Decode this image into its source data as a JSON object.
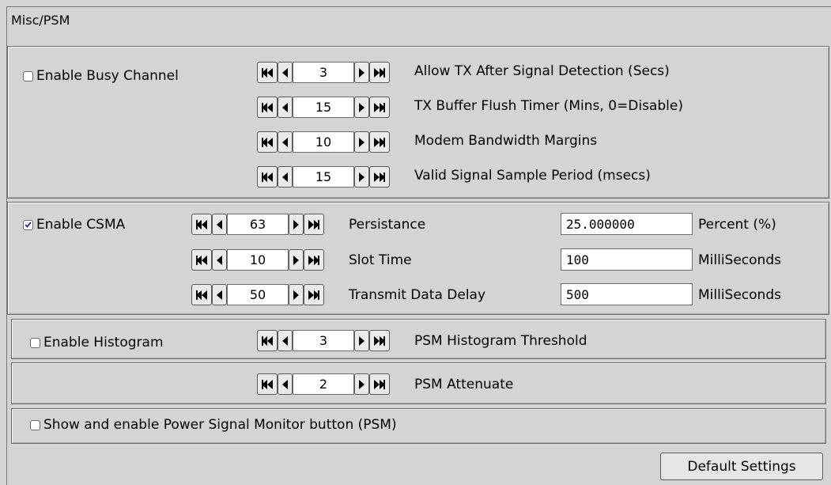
{
  "section_title": "Misc/PSM",
  "busy": {
    "enable_label": "Enable Busy Channel",
    "enabled": false,
    "counters": [
      {
        "value": "3",
        "label": "Allow TX After Signal Detection (Secs)"
      },
      {
        "value": "15",
        "label": "TX Buffer Flush Timer (Mins, 0=Disable)"
      },
      {
        "value": "10",
        "label": "Modem Bandwidth Margins"
      },
      {
        "value": "15",
        "label": "Valid Signal Sample Period (msecs)"
      }
    ]
  },
  "csma": {
    "enable_label": "Enable CSMA",
    "enabled": true,
    "rows": [
      {
        "value": "63",
        "label": "Persistance",
        "field": "25.000000",
        "unit": "Percent (%)"
      },
      {
        "value": "10",
        "label": "Slot Time",
        "field": "100",
        "unit": "MilliSeconds"
      },
      {
        "value": "50",
        "label": "Transmit Data Delay",
        "field": "500",
        "unit": "MilliSeconds"
      }
    ]
  },
  "histogram": {
    "enable_label": "Enable Histogram",
    "enabled": false,
    "value": "3",
    "label": "PSM Histogram Threshold"
  },
  "attenuate": {
    "value": "2",
    "label": "PSM Attenuate"
  },
  "psm": {
    "label": "Show and enable Power Signal Monitor button (PSM)",
    "enabled": false
  },
  "default_button": "Default Settings",
  "icons": {
    "fast_back": "fast-backward-icon",
    "back": "step-backward-icon",
    "forward": "step-forward-icon",
    "fast_forward": "fast-forward-icon",
    "check": "check-icon"
  }
}
